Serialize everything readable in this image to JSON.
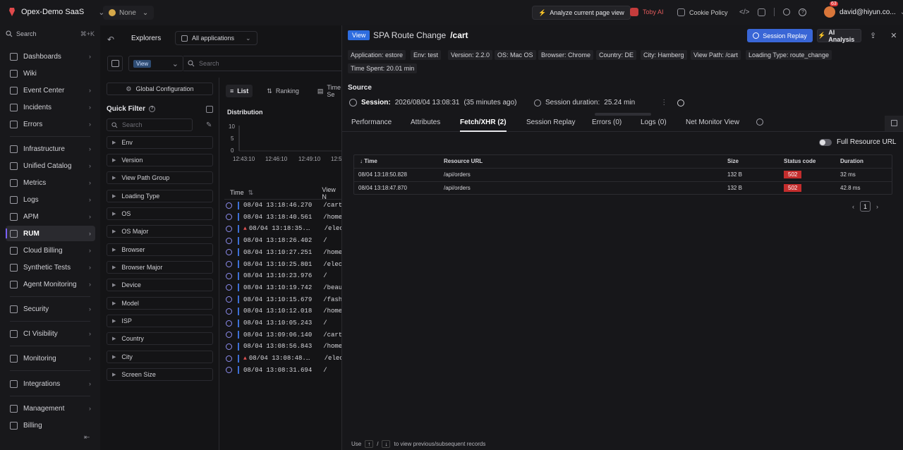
{
  "topbar": {
    "org_name": "Opex-Demo SaaS",
    "env_label": "None",
    "analyze_label": "Analyze current page view",
    "user_chip": "Toby AI",
    "cookie_label": "Cookie Policy",
    "account": "david@hiyun.co...",
    "notification_count": "63"
  },
  "sidebar": {
    "search_label": "Search",
    "search_shortcut": "⌘+K",
    "items": [
      {
        "label": "Dashboards"
      },
      {
        "label": "Wiki"
      },
      {
        "label": "Event Center"
      },
      {
        "label": "Incidents"
      },
      {
        "label": "Errors"
      },
      {
        "label": "Infrastructure"
      },
      {
        "label": "Unified Catalog"
      },
      {
        "label": "Metrics"
      },
      {
        "label": "Logs"
      },
      {
        "label": "APM"
      },
      {
        "label": "RUM"
      },
      {
        "label": "Cloud Billing"
      },
      {
        "label": "Synthetic Tests"
      },
      {
        "label": "Agent Monitoring"
      },
      {
        "label": "Security"
      },
      {
        "label": "CI Visibility"
      },
      {
        "label": "Monitoring"
      },
      {
        "label": "Integrations"
      },
      {
        "label": "Management"
      },
      {
        "label": "Billing"
      }
    ]
  },
  "explorer": {
    "title": "Explorers",
    "app_selector": "All applications",
    "view_tag": "View",
    "search_placeholder": "Search",
    "global_config": "Global Configuration",
    "quick_filter": "Quick Filter",
    "filter_search_placeholder": "Search",
    "facets": [
      "Env",
      "Version",
      "View Path Group",
      "Loading Type",
      "OS",
      "OS Major",
      "Browser",
      "Browser Major",
      "Device",
      "Model",
      "ISP",
      "Country",
      "City",
      "Screen Size"
    ],
    "tabs": [
      "List",
      "Ranking",
      "Time Se"
    ],
    "distribution_label": "Distribution",
    "table_headers": {
      "time": "Time",
      "view": "View N"
    },
    "rows": [
      {
        "time": "08/04  13:18:46.270",
        "view": "/cart",
        "warn": false
      },
      {
        "time": "08/04  13:18:40.561",
        "view": "/home",
        "warn": false
      },
      {
        "time": "08/04  13:18:35.…",
        "view": "/elec",
        "warn": true
      },
      {
        "time": "08/04  13:18:26.402",
        "view": "/",
        "warn": false
      },
      {
        "time": "08/04  13:10:27.251",
        "view": "/home",
        "warn": false
      },
      {
        "time": "08/04  13:10:25.801",
        "view": "/elec",
        "warn": false
      },
      {
        "time": "08/04  13:10:23.976",
        "view": "/",
        "warn": false
      },
      {
        "time": "08/04  13:10:19.742",
        "view": "/beau",
        "warn": false
      },
      {
        "time": "08/04  13:10:15.679",
        "view": "/fash",
        "warn": false
      },
      {
        "time": "08/04  13:10:12.018",
        "view": "/home",
        "warn": false
      },
      {
        "time": "08/04  13:10:05.243",
        "view": "/",
        "warn": false
      },
      {
        "time": "08/04  13:09:06.140",
        "view": "/cart",
        "warn": false
      },
      {
        "time": "08/04  13:08:56.843",
        "view": "/home",
        "warn": false
      },
      {
        "time": "08/04  13:08:48.…",
        "view": "/elec",
        "warn": true
      },
      {
        "time": "08/04  13:08:31.694",
        "view": "/",
        "warn": false
      }
    ]
  },
  "chart_data": {
    "type": "bar",
    "title": "Distribution",
    "y_ticks": [
      "10",
      "5",
      "0"
    ],
    "x_ticks": [
      "12:43:10",
      "12:46:10",
      "12:49:10",
      "12:5"
    ],
    "ylim": [
      0,
      10
    ]
  },
  "detail": {
    "tag": "View",
    "title_prefix": "SPA Route Change",
    "title_path": "/cart",
    "session_replay_btn": "Session Replay",
    "ai_btn": "AI Analysis",
    "attributes": [
      {
        "k": "Application:",
        "v": "estore"
      },
      {
        "k": "Env:",
        "v": "test"
      },
      {
        "k": "Version:",
        "v": "2.2.0"
      },
      {
        "k": "OS:",
        "v": "Mac OS"
      },
      {
        "k": "Browser:",
        "v": "Chrome"
      },
      {
        "k": "Country:",
        "v": "DE"
      },
      {
        "k": "City:",
        "v": "Hamberg"
      },
      {
        "k": "View Path:",
        "v": "/cart"
      },
      {
        "k": "Loading Type:",
        "v": "route_change"
      },
      {
        "k": "Time Spent:",
        "v": "20.01 min"
      }
    ],
    "source_label": "Source",
    "session_label": "Session:",
    "session_value": "2026/08/04 13:08:31",
    "session_ago": "(35 minutes ago)",
    "duration_label": "Session duration:",
    "duration_value": "25.24 min",
    "tabs": [
      "Performance",
      "Attributes",
      "Fetch/XHR (2)",
      "Session Replay",
      "Errors (0)",
      "Logs (0)",
      "Net Monitor View"
    ],
    "full_url_label": "Full Resource URL",
    "xhr_headers": {
      "time": "Time",
      "url": "Resource URL",
      "size": "Size",
      "status": "Status code",
      "duration": "Duration"
    },
    "xhr_rows": [
      {
        "time": "08/04 13:18:50.828",
        "url": "/api/orders",
        "size": "132 B",
        "status": "502",
        "duration": "32 ms"
      },
      {
        "time": "08/04 13:18:47.870",
        "url": "/api/orders",
        "size": "132 B",
        "status": "502",
        "duration": "42.8 ms"
      }
    ],
    "page_number": "1",
    "hint_use": "Use",
    "hint_up": "↑",
    "hint_sep": "/",
    "hint_down": "↓",
    "hint_text": "to view previous/subsequent records"
  }
}
